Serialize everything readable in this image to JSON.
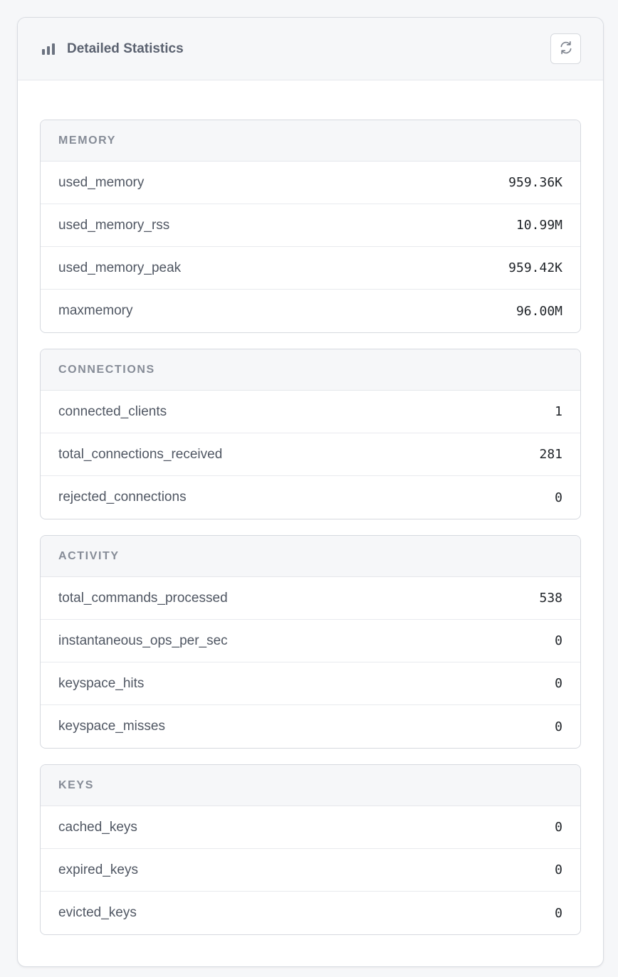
{
  "header": {
    "title": "Detailed Statistics",
    "icon": "bar-chart-icon",
    "refresh_icon": "refresh-icon"
  },
  "colors": {
    "accent_gray": "#868c97",
    "border": "#d6d9df",
    "header_bg": "#f6f7f9"
  },
  "sections": [
    {
      "title": "MEMORY",
      "rows": [
        {
          "label": "used_memory",
          "value": "959.36K"
        },
        {
          "label": "used_memory_rss",
          "value": "10.99M"
        },
        {
          "label": "used_memory_peak",
          "value": "959.42K"
        },
        {
          "label": "maxmemory",
          "value": "96.00M"
        }
      ]
    },
    {
      "title": "CONNECTIONS",
      "rows": [
        {
          "label": "connected_clients",
          "value": "1"
        },
        {
          "label": "total_connections_received",
          "value": "281"
        },
        {
          "label": "rejected_connections",
          "value": "0"
        }
      ]
    },
    {
      "title": "ACTIVITY",
      "rows": [
        {
          "label": "total_commands_processed",
          "value": "538"
        },
        {
          "label": "instantaneous_ops_per_sec",
          "value": "0"
        },
        {
          "label": "keyspace_hits",
          "value": "0"
        },
        {
          "label": "keyspace_misses",
          "value": "0"
        }
      ]
    },
    {
      "title": "KEYS",
      "rows": [
        {
          "label": "cached_keys",
          "value": "0"
        },
        {
          "label": "expired_keys",
          "value": "0"
        },
        {
          "label": "evicted_keys",
          "value": "0"
        }
      ]
    }
  ]
}
